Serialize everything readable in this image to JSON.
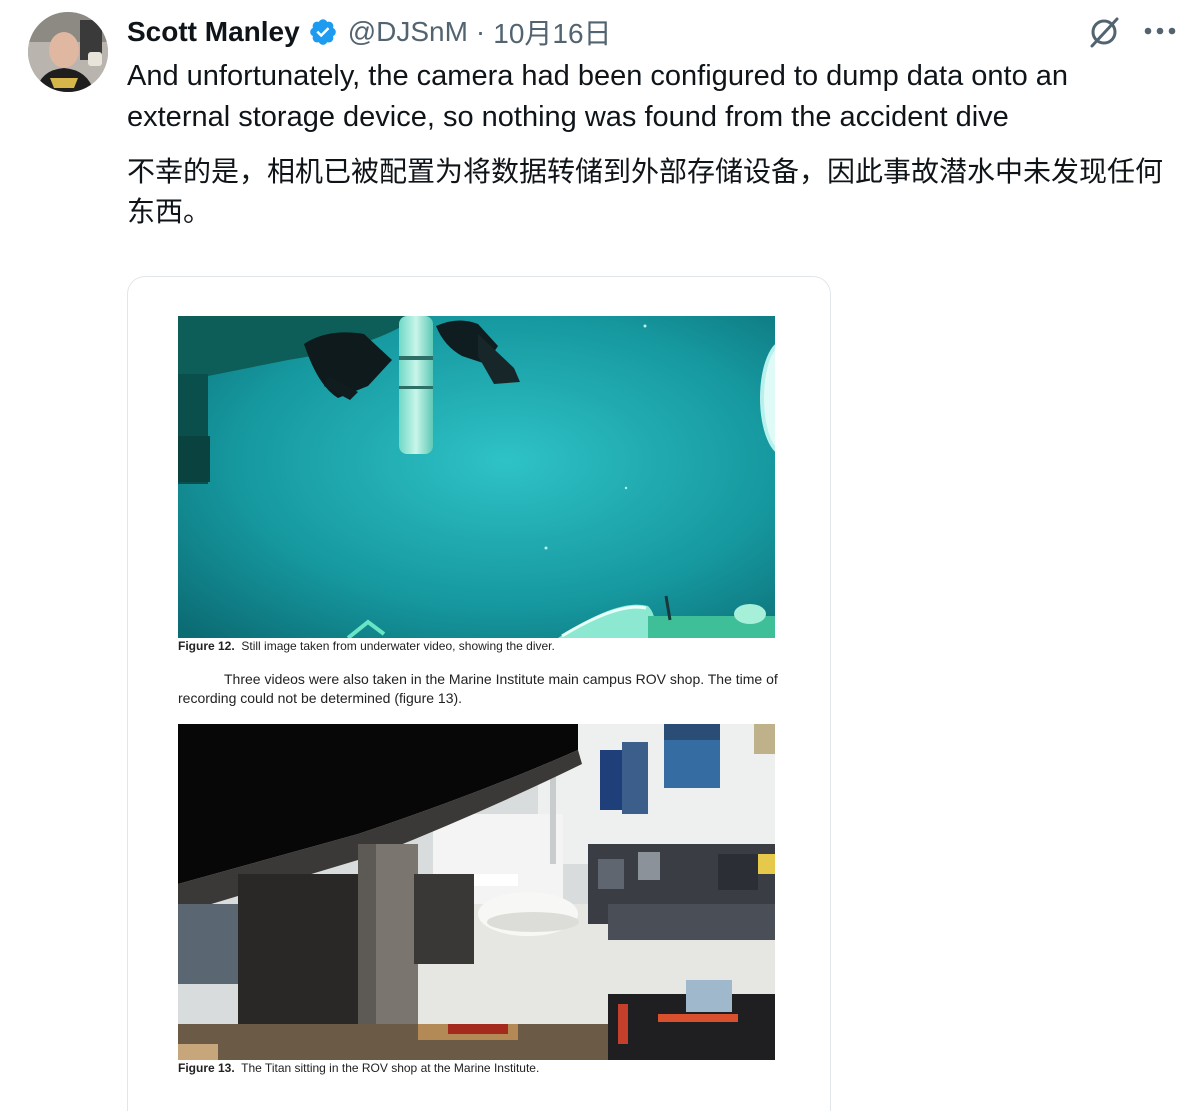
{
  "tweet": {
    "author_name": "Scott Manley",
    "handle": "@DJSnM",
    "separator": "·",
    "date": "10月16日",
    "text_en": "And unfortunately, the camera had been configured to dump data onto an external storage device, so nothing was found from the accident dive",
    "text_zh": "不幸的是，相机已被配置为将数据转储到外部存储设备，因此事故潜水中未发现任何东西。"
  },
  "icons": {
    "verified": "verified-badge-icon",
    "grok": "grok-icon",
    "more": "more-options-icon"
  },
  "document": {
    "figure12": {
      "label": "Figure 12.",
      "caption": "Still image taken from underwater video, showing the diver."
    },
    "paragraph": "Three videos were also taken in the Marine Institute main campus ROV shop. The time of recording could not be determined (figure 13).",
    "figure13": {
      "label": "Figure 13.",
      "caption": "The Titan sitting in the ROV shop at the Marine Institute."
    }
  },
  "colors": {
    "verified_blue": "#1d9bf0",
    "underwater_teal": "#14a0a6",
    "text_primary": "#0f1419",
    "text_secondary": "#536471"
  }
}
